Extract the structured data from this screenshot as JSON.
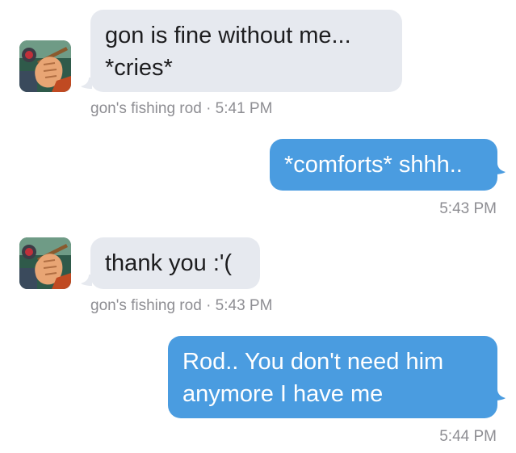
{
  "messages": [
    {
      "direction": "incoming",
      "lines": [
        "gon is fine without me...",
        "*cries*"
      ],
      "sender": "gon's fishing rod",
      "separator": "·",
      "time": "5:41 PM"
    },
    {
      "direction": "outgoing",
      "lines": [
        "*comforts* shhh.."
      ],
      "time": "5:43 PM"
    },
    {
      "direction": "incoming",
      "lines": [
        "thank you :'("
      ],
      "sender": "gon's fishing rod",
      "separator": "·",
      "time": "5:43 PM"
    },
    {
      "direction": "outgoing",
      "lines": [
        "Rod.. You don't need him",
        "anymore I have me"
      ],
      "time": "5:44 PM"
    }
  ],
  "colors": {
    "incoming_bubble": "#e6e9ef",
    "outgoing_bubble": "#4a9ce0",
    "meta_text": "#8e8e93"
  },
  "icons": {
    "avatar": "fishing-rod-hand-avatar"
  }
}
